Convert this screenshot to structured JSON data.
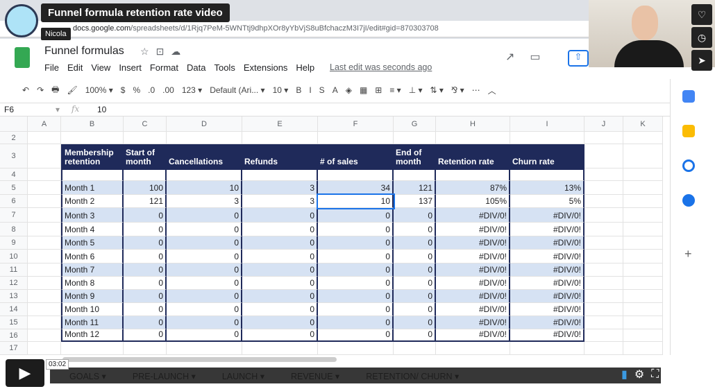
{
  "video": {
    "title": "Funnel formula retention rate video",
    "author": "Nicola",
    "timecode": "03:02",
    "brand": "vimeo"
  },
  "browser": {
    "url_host": "docs.google.com",
    "url_path": "/spreadsheets/d/1Rjq7PeM-5WNTtj9dhpXOr8yYbVjS8uBfchaczM3I7jI/edit#gid=870303708"
  },
  "doc": {
    "title": "Funnel formulas",
    "menu": [
      "File",
      "Edit",
      "View",
      "Insert",
      "Format",
      "Data",
      "Tools",
      "Extensions",
      "Help"
    ],
    "last_edit": "Last edit was seconds ago"
  },
  "toolbar": {
    "items": [
      "↶",
      "↷",
      "🖶",
      "🖌",
      "100% ▾",
      "$",
      "%",
      ".0",
      "​.00",
      "123 ▾",
      "Default (Ari... ▾",
      "10 ▾",
      "B",
      "I",
      "S",
      "A",
      "◈",
      "▦",
      "⊞",
      "≡ ▾",
      "⊥ ▾",
      "⇅ ▾",
      "⅋ ▾",
      "⋯",
      "︿"
    ]
  },
  "formula_bar": {
    "cell_ref": "F6",
    "fx": "fx",
    "value": "10"
  },
  "columns": [
    "A",
    "B",
    "C",
    "D",
    "E",
    "F",
    "G",
    "H",
    "I",
    "J",
    "K"
  ],
  "row_numbers": [
    "2",
    "3",
    "4",
    "5",
    "6",
    "7",
    "8",
    "9",
    "10",
    "11",
    "12",
    "13",
    "14",
    "15",
    "16",
    "17"
  ],
  "table": {
    "headers": [
      "Membership retention",
      "Start of month",
      "Cancellations",
      "Refunds",
      "# of sales",
      "End of month",
      "Retention rate",
      "Churn rate"
    ],
    "rows": [
      [
        "Month 1",
        "100",
        "10",
        "3",
        "34",
        "121",
        "87%",
        "13%"
      ],
      [
        "Month 2",
        "121",
        "3",
        "3",
        "10",
        "137",
        "105%",
        "5%"
      ],
      [
        "Month 3",
        "0",
        "0",
        "0",
        "0",
        "0",
        "#DIV/0!",
        "#DIV/0!"
      ],
      [
        "Month 4",
        "0",
        "0",
        "0",
        "0",
        "0",
        "#DIV/0!",
        "#DIV/0!"
      ],
      [
        "Month 5",
        "0",
        "0",
        "0",
        "0",
        "0",
        "#DIV/0!",
        "#DIV/0!"
      ],
      [
        "Month 6",
        "0",
        "0",
        "0",
        "0",
        "0",
        "#DIV/0!",
        "#DIV/0!"
      ],
      [
        "Month 7",
        "0",
        "0",
        "0",
        "0",
        "0",
        "#DIV/0!",
        "#DIV/0!"
      ],
      [
        "Month 8",
        "0",
        "0",
        "0",
        "0",
        "0",
        "#DIV/0!",
        "#DIV/0!"
      ],
      [
        "Month 9",
        "0",
        "0",
        "0",
        "0",
        "0",
        "#DIV/0!",
        "#DIV/0!"
      ],
      [
        "Month 10",
        "0",
        "0",
        "0",
        "0",
        "0",
        "#DIV/0!",
        "#DIV/0!"
      ],
      [
        "Month 11",
        "0",
        "0",
        "0",
        "0",
        "0",
        "#DIV/0!",
        "#DIV/0!"
      ],
      [
        "Month 12",
        "0",
        "0",
        "0",
        "0",
        "0",
        "#DIV/0!",
        "#DIV/0!"
      ]
    ]
  },
  "sheet_tabs": [
    "GOALS ▾",
    "PRE-LAUNCH ▾",
    "LAUNCH ▾",
    "REVENUE ▾",
    "RETENTION/ CHURN ▾"
  ],
  "colors": {
    "header_bg": "#1f2a5a",
    "band": "#d6e2f3",
    "sheets_green": "#34a853",
    "selection": "#1a73e8"
  }
}
